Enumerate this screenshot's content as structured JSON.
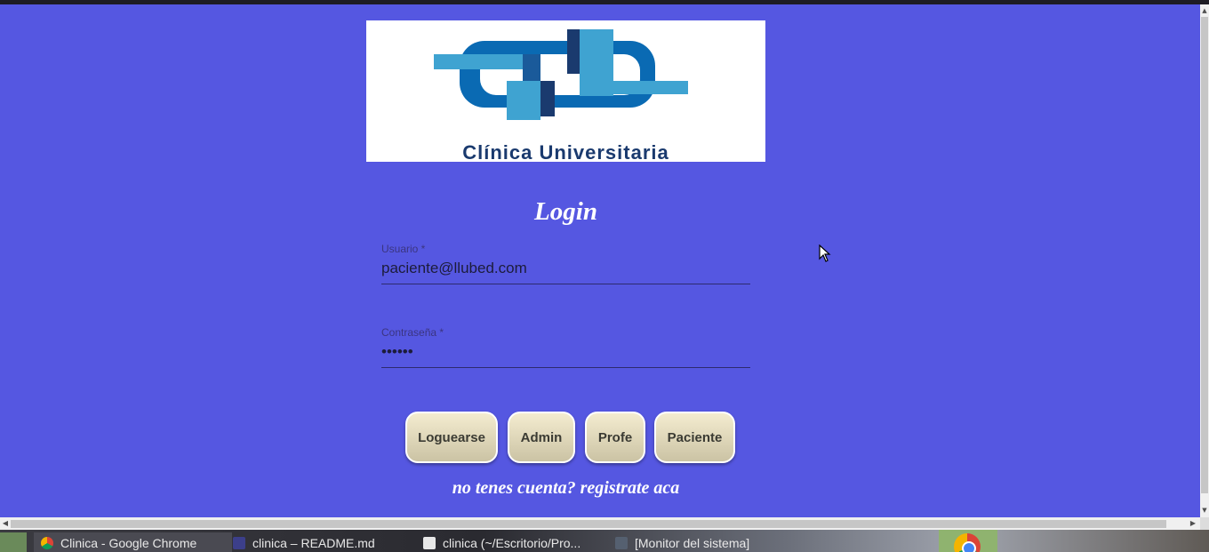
{
  "logo": {
    "text": "Clínica Universitaria",
    "colors": {
      "dark": "#1a3a6e",
      "mid": "#0a6ab3",
      "light": "#3fa3d1"
    }
  },
  "login": {
    "title": "Login",
    "username": {
      "label": "Usuario *",
      "value": "paciente@llubed.com"
    },
    "password": {
      "label": "Contraseña *",
      "value": "••••••"
    }
  },
  "buttons": {
    "login": "Loguearse",
    "admin": "Admin",
    "profe": "Profe",
    "paciente": "Paciente"
  },
  "register_link": "no tenes cuenta? registrate aca",
  "taskbar": {
    "items": [
      {
        "label": "Clinica - Google Chrome",
        "icon": "chrome-icon"
      },
      {
        "label": "clinica – README.md",
        "icon": "ide-icon"
      },
      {
        "label": "clinica (~/Escritorio/Pro...",
        "icon": "text-editor-icon"
      },
      {
        "label": "[Monitor del sistema]",
        "icon": "system-monitor-icon"
      }
    ]
  },
  "colors": {
    "background": "#5557e1",
    "button": "#e7dfc2",
    "text": "#ffffff"
  }
}
